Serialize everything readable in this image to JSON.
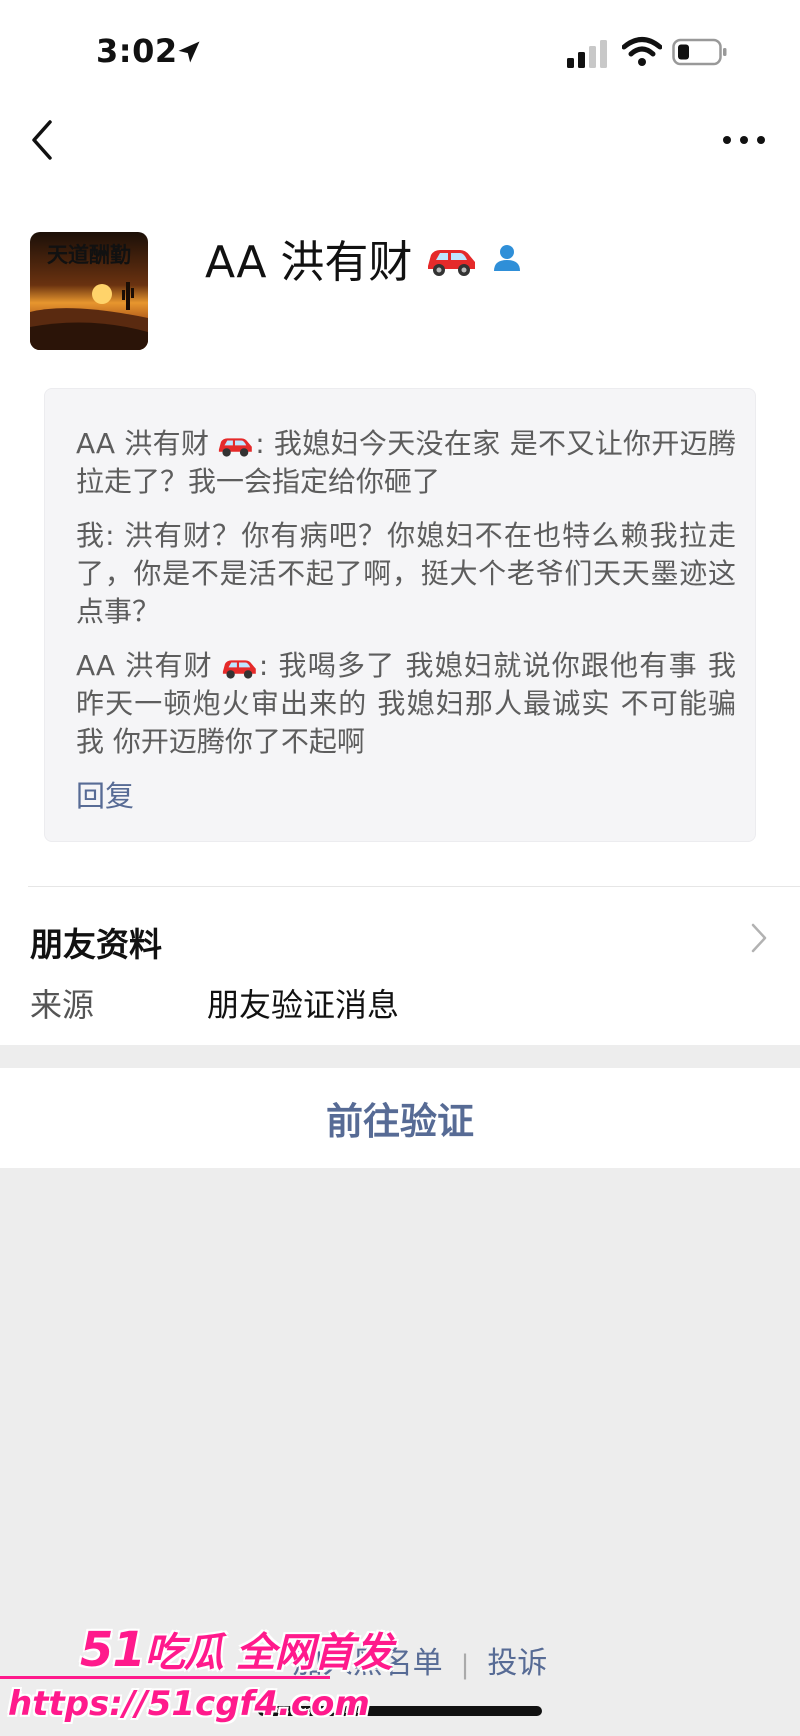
{
  "status_bar": {
    "time": "3:02"
  },
  "profile": {
    "name": "AA 洪有财",
    "avatar_text": "天道酬勤"
  },
  "messages": [
    {
      "sender": "AA 洪有财",
      "text": ": 我媳妇今天没在家 是不又让你开迈腾拉走了？我一会指定给你砸了"
    },
    {
      "sender": "我",
      "text": ": 洪有财？你有病吧？你媳妇不在也特么赖我拉走了，你是不是活不起了啊，挺大个老爷们天天墨迹这点事？"
    },
    {
      "sender": "AA 洪有财",
      "text": ": 我喝多了 我媳妇就说你跟他有事 我昨天一顿炮火审出来的 我媳妇那人最诚实 不可能骗我 你开迈腾你了不起啊"
    }
  ],
  "reply_label": "回复",
  "friend_info": {
    "title": "朋友资料",
    "source_label": "来源",
    "source_value": "朋友验证消息"
  },
  "verify_button": "前往验证",
  "bottom_links": {
    "blacklist": "加入黑名单",
    "report": "投诉"
  },
  "watermark": {
    "brand": "51",
    "slogan": "吃瓜 全网首发",
    "url": "https://51cgf4.com"
  },
  "colors": {
    "link": "#576b95",
    "watermark": "#ff1a8c"
  }
}
